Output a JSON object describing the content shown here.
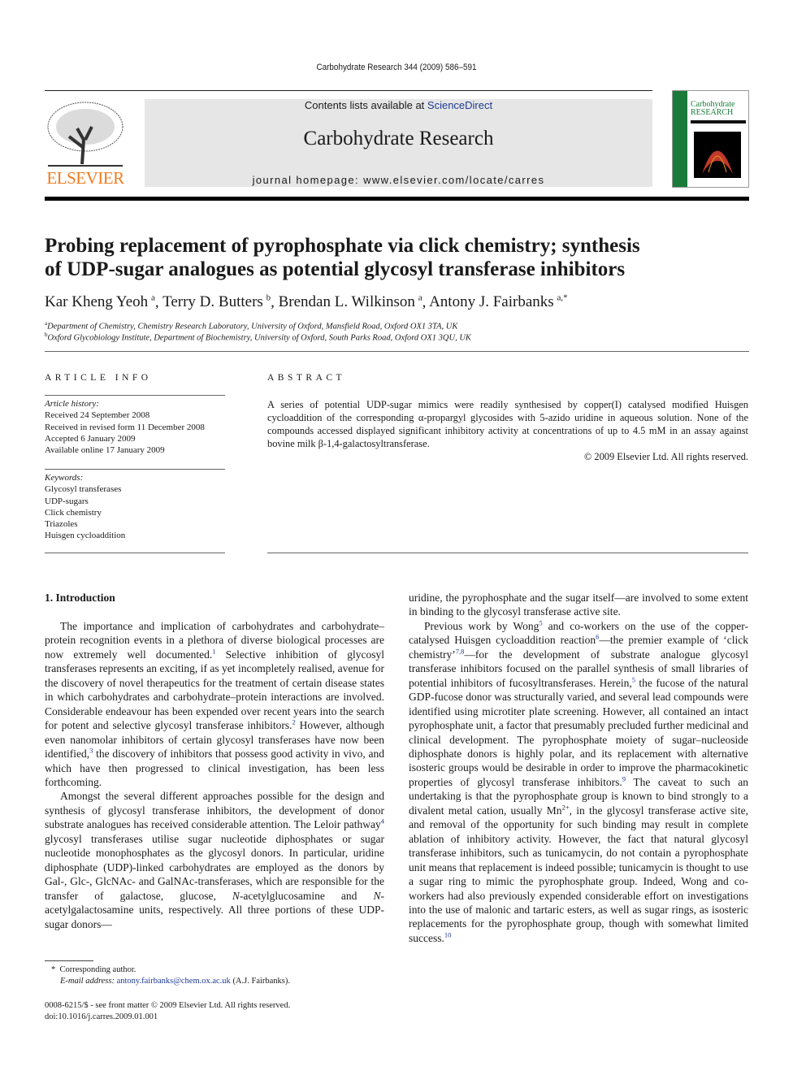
{
  "running_head": "Carbohydrate Research 344 (2009) 586–591",
  "masthead": {
    "contents_prefix": "Contents lists available at ",
    "sciencedirect": "ScienceDirect",
    "journal_title": "Carbohydrate Research",
    "homepage": "journal homepage: www.elsevier.com/locate/carres",
    "publisher_logo": "ELSEVIER",
    "cover_title_1": "Carbohydrate",
    "cover_title_2": "RESEARCH",
    "brand_color": "#f07b1d",
    "cover_color": "#1a7a3a",
    "link_color": "#1f3a93"
  },
  "article": {
    "title_line1": "Probing replacement of pyrophosphate via click chemistry; synthesis",
    "title_line2": "of UDP-sugar analogues as potential glycosyl transferase inhibitors",
    "authors": [
      {
        "name": "Kar Kheng Yeoh",
        "sup": "a"
      },
      {
        "name": "Terry D. Butters",
        "sup": "b"
      },
      {
        "name": "Brendan L. Wilkinson",
        "sup": "a"
      },
      {
        "name": "Antony J. Fairbanks",
        "sup": "a,*"
      }
    ],
    "affiliations": [
      {
        "sup": "a",
        "text": "Department of Chemistry, Chemistry Research Laboratory, University of Oxford, Mansfield Road, Oxford OX1 3TA, UK"
      },
      {
        "sup": "b",
        "text": "Oxford Glycobiology Institute, Department of Biochemistry, University of Oxford, South Parks Road, Oxford OX1 3QU, UK"
      }
    ]
  },
  "article_info": {
    "heading": "ARTICLE INFO",
    "history_label": "Article history:",
    "history": [
      "Received 24 September 2008",
      "Received in revised form 11 December 2008",
      "Accepted 6 January 2009",
      "Available online 17 January 2009"
    ],
    "keywords_label": "Keywords:",
    "keywords": [
      "Glycosyl transferases",
      "UDP-sugars",
      "Click chemistry",
      "Triazoles",
      "Huisgen cycloaddition"
    ]
  },
  "abstract": {
    "heading": "ABSTRACT",
    "text": "A series of potential UDP-sugar mimics were readily synthesised by copper(I) catalysed modified Huisgen cycloaddition of the corresponding α-propargyl glycosides with 5-azido uridine in aqueous solution. None of the compounds accessed displayed significant inhibitory activity at concentrations of up to 4.5 mM in an assay against bovine milk β-1,4-galactosyltransferase.",
    "copyright": "© 2009 Elsevier Ltd. All rights reserved."
  },
  "intro": {
    "heading": "1.  Introduction",
    "left_paragraphs": [
      [
        {
          "t": "The importance and implication of carbohydrates and carbohydrate–protein recognition events in a plethora of diverse biological processes are now extremely well documented."
        },
        {
          "r": "1"
        },
        {
          "t": " Selective inhibition of glycosyl transferases represents an exciting, if as yet incompletely realised, avenue for the discovery of novel therapeutics for the treatment of certain disease states in which carbohydrates and carbohydrate–protein interactions are involved. Considerable endeavour has been expended over recent years into the search for potent and selective glycosyl transferase inhibitors."
        },
        {
          "r": "2"
        },
        {
          "t": " However, although even nanomolar inhibitors of certain glycosyl transferases have now been identified,"
        },
        {
          "r": "3"
        },
        {
          "t": " the discovery of inhibitors that possess good activity in vivo, and which have then progressed to clinical investigation, has been less forthcoming."
        }
      ],
      [
        {
          "t": "Amongst the several different approaches possible for the design and synthesis of glycosyl transferase inhibitors, the development of donor substrate analogues has received considerable attention. The Leloir pathway"
        },
        {
          "r": "4"
        },
        {
          "t": " glycosyl transferases utilise sugar nucleotide diphosphates or sugar nucleotide monophosphates as the glycosyl donors. In particular, uridine diphosphate (UDP)-linked carbohydrates are employed as the donors by Gal-, Glc-, GlcNAc- and GalNAc-transferases, which are responsible for the transfer of galactose, glucose, "
        },
        {
          "i": "N"
        },
        {
          "t": "-acetylglucosamine and "
        },
        {
          "i": "N"
        },
        {
          "t": "-acetylgalactosamine units, respectively. All three portions of these UDP-sugar donors—"
        }
      ]
    ],
    "right_paragraphs": [
      [
        {
          "t": "uridine, the pyrophosphate and the sugar itself—are involved to some extent in binding to the glycosyl transferase active site."
        }
      ],
      [
        {
          "t": "Previous work by Wong"
        },
        {
          "r": "5"
        },
        {
          "t": " and co-workers on the use of the copper-catalysed Huisgen cycloaddition reaction"
        },
        {
          "r": "6"
        },
        {
          "t": "—the premier example of ‘click chemistry’"
        },
        {
          "r": "7,8"
        },
        {
          "t": "—for the development of substrate analogue glycosyl transferase inhibitors focused on the parallel synthesis of small libraries of potential inhibitors of fucosyltransferases. Herein,"
        },
        {
          "r": "5"
        },
        {
          "t": " the fucose of the natural GDP-fucose donor was structurally varied, and several lead compounds were identified using microtiter plate screening. However, all contained an intact pyrophosphate unit, a factor that presumably precluded further medicinal and clinical development. The pyrophosphate moiety of sugar–nucleoside diphosphate donors is highly polar, and its replacement with alternative isosteric groups would be desirable in order to improve the pharmacokinetic properties of glycosyl transferase inhibitors."
        },
        {
          "r": "9"
        },
        {
          "t": " The caveat to such an undertaking is that the pyrophosphate group is known to bind strongly to a divalent metal cation, usually Mn"
        },
        {
          "s": "2+"
        },
        {
          "t": ", in the glycosyl transferase active site, and removal of the opportunity for such binding may result in complete ablation of inhibitory activity. However, the fact that natural glycosyl transferase inhibitors, such as tunicamycin, do not contain a pyrophosphate unit means that replacement is indeed possible; tunicamycin is thought to use a sugar ring to mimic the pyrophosphate group. Indeed, Wong and co-workers had also previously expended considerable effort on investigations into the use of malonic and tartaric esters, as well as sugar rings, as isosteric replacements for the pyrophosphate group, though with somewhat limited success."
        },
        {
          "r": "10"
        }
      ]
    ]
  },
  "footnote": {
    "star": "*",
    "corresponding": "Corresponding author.",
    "email_label": "E-mail address: ",
    "email": "antony.fairbanks@chem.ox.ac.uk",
    "email_suffix": " (A.J. Fairbanks)."
  },
  "front_matter": {
    "issn": "0008-6215/$ - see front matter © 2009 Elsevier Ltd. All rights reserved.",
    "doi": "doi:10.1016/j.carres.2009.01.001"
  }
}
